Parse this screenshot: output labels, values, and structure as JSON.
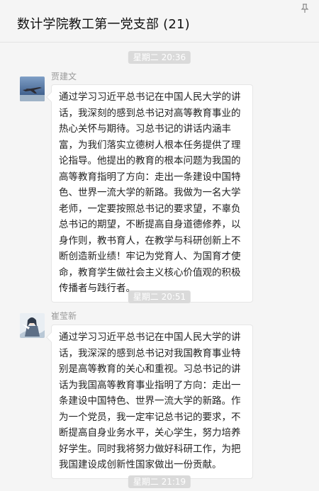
{
  "header": {
    "title": "数计学院教工第一党支部 (21)",
    "pin_icon": "pin-icon"
  },
  "timestamps": [
    "星期二 20:36",
    "星期二 20:51",
    "星期二 21:19"
  ],
  "messages": [
    {
      "sender": "贾建文",
      "avatar_icon": "avatar-jet-image",
      "text": "通过学习习近平总书记在中国人民大学的讲话，我深刻的感到总书记对高等教育事业的热心关怀与期待。习总书记的讲话内涵丰富，为我们落实立德树人根本任务提供了理论指导。他提出的教育的根本问题为我国的高等教育指明了方向：走出一条建设中国特色、世界一流大学的新路。我做为一名大学老师，一定要按照总书记的要求望，不辜负总书记的期望，不断提高自身道德修养，以身作则，教书育人，在教学与科研创新上不断创造新业绩！牢记为党育人、为国育才使命，教育学生做社会主义核心价值观的积极传播者与践行者。"
    },
    {
      "sender": "崔莹新",
      "avatar_icon": "avatar-anime-image",
      "text": "通过学习习近平总书记在中国人民大学的讲话，我深深的感到总书记对我国教育事业特别是高等教育的关心和重视。习总书记的讲话为我国高等教育事业指明了方向：走出一条建设中国特色、世界一流大学的新路。作为一个党员，我一定牢记总书记的要求，不断提高自身业务水平，关心学生，努力培养好学生。同时我将努力做好科研工作，为把我国建设成创新性国家做出一份贡献。"
    }
  ],
  "colors": {
    "background": "#f5f5f5",
    "bubble": "#ffffff",
    "time_pill": "#dadada",
    "sender_text": "#9a9a9a"
  }
}
